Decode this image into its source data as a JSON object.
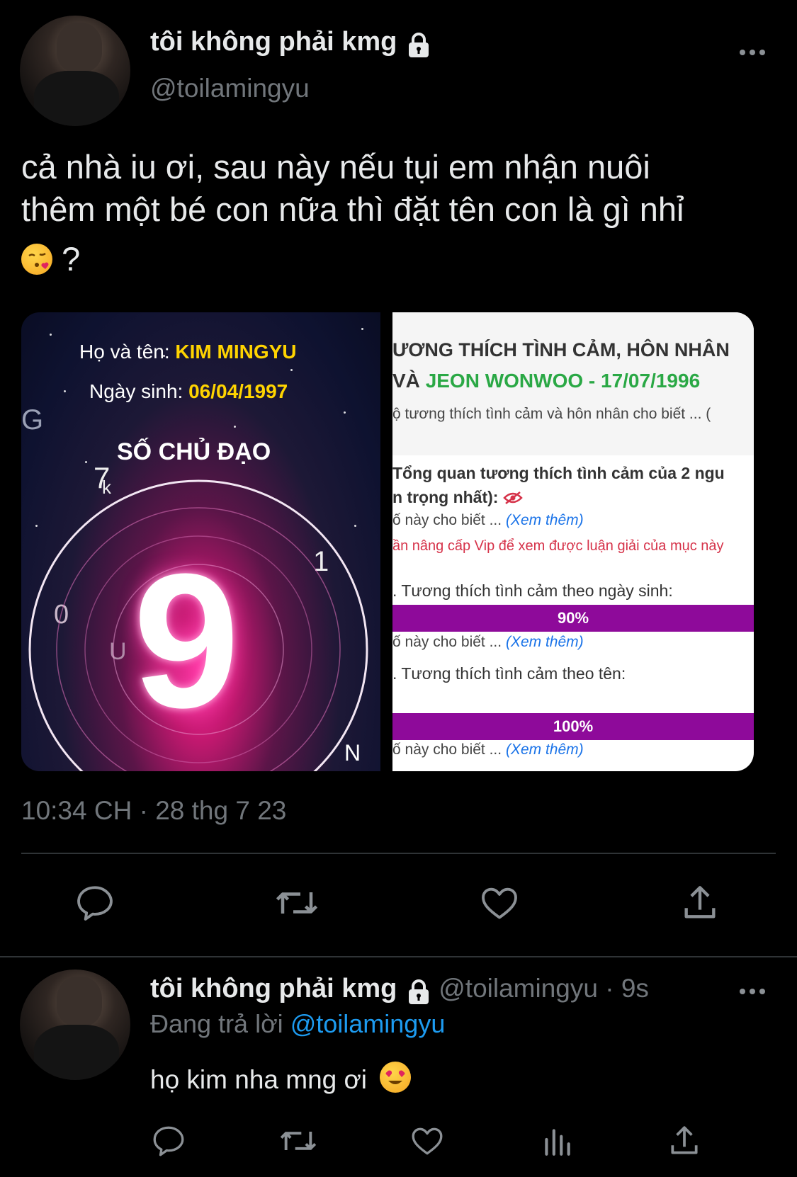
{
  "main_tweet": {
    "display_name": "tôi không phải kmg",
    "handle": "@toilamingyu",
    "text_line1": "cả nhà iu ơi, sau này nếu tụi em nhận nuôi",
    "text_line2": "thêm một bé con nữa thì đặt tên con là gì nhỉ",
    "text_tail": "?",
    "timestamp": "10:34 CH · 28 thg 7 23"
  },
  "left_image": {
    "name_label": "Họ và tên:",
    "name_value": "KIM MINGYU",
    "dob_label": "Ngày sinh:",
    "dob_value": "06/04/1997",
    "heading": "SỐ CHỦ ĐẠO",
    "big_number": "9",
    "letters": [
      "G",
      "7",
      "k",
      "1",
      "0",
      "U",
      "N"
    ]
  },
  "right_image": {
    "title_line1": "ƯƠNG THÍCH TÌNH CẢM, HÔN NHÂN",
    "title_line2_prefix": "VÀ ",
    "title_line2_highlight": "JEON WONWOO - 17/07/1996",
    "intro": "ộ tương thích tình cảm và hôn nhân cho biết ... (",
    "overview_line1": "Tổng quan tương thích tình cảm của 2 ngu",
    "overview_line2": "n trọng nhất):",
    "see_more_prefix": "ố này cho biết ... ",
    "see_more_link": "(Xem thêm)",
    "vip_note": "ần nâng cấp Vip để xem được luận giải của mục này",
    "section1": ". Tương thích tình cảm theo ngày sinh:",
    "bar1_value": "90%",
    "section2": ". Tương thích tình cảm theo tên:",
    "bar2_value": "100%",
    "colors": {
      "highlight_green": "#2aa845",
      "bar_purple": "#8e0a9a",
      "vip_red": "#d6334a",
      "link_blue": "#1a73e8"
    }
  },
  "actions_main": [
    "reply-icon",
    "retweet-icon",
    "like-icon",
    "share-icon"
  ],
  "reply": {
    "display_name": "tôi không phải kmg",
    "handle_time": "@toilamingyu · 9s",
    "replying_to_label": "Đang trả lời",
    "replying_to_handle": "@toilamingyu",
    "text": "họ kim nha mng ơi"
  },
  "actions_reply": [
    "reply-icon",
    "retweet-icon",
    "like-icon",
    "analytics-icon",
    "share-icon"
  ],
  "colors": {
    "background": "#000000",
    "text": "#e7e9ea",
    "muted": "#71767b",
    "accent": "#1d9bf0",
    "divider": "#2f3336"
  }
}
